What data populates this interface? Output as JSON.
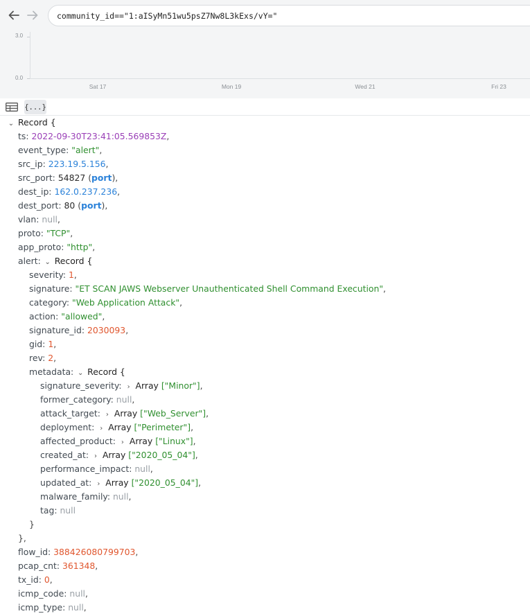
{
  "search": {
    "query": "community_id==\"1:aISyMn51wu5psZ7Nw8L3kExs/vY=\""
  },
  "histogram": {
    "y_labels": [
      "3.0",
      "0.0"
    ],
    "x_labels": [
      "Sat 17",
      "Mon 19",
      "Wed 21",
      "Fri 23"
    ]
  },
  "view": {
    "json_label": "{...}"
  },
  "record": {
    "root_label": "Record {",
    "ts": {
      "key": "ts:",
      "value": "2022-09-30T23:41:05.569853Z"
    },
    "event_type": {
      "key": "event_type:",
      "value": "\"alert\""
    },
    "src_ip": {
      "key": "src_ip:",
      "value": "223.19.5.156"
    },
    "src_port": {
      "key": "src_port:",
      "value": "54827",
      "type": "port"
    },
    "dest_ip": {
      "key": "dest_ip:",
      "value": "162.0.237.236"
    },
    "dest_port": {
      "key": "dest_port:",
      "value": "80",
      "type": "port"
    },
    "vlan": {
      "key": "vlan:",
      "value": "null"
    },
    "proto": {
      "key": "proto:",
      "value": "\"TCP\""
    },
    "app_proto": {
      "key": "app_proto:",
      "value": "\"http\""
    },
    "alert": {
      "key": "alert:",
      "label": "Record {",
      "severity": {
        "key": "severity:",
        "value": "1"
      },
      "signature": {
        "key": "signature:",
        "value": "\"ET SCAN JAWS Webserver Unauthenticated Shell Command Execution\""
      },
      "category": {
        "key": "category:",
        "value": "\"Web Application Attack\""
      },
      "action": {
        "key": "action:",
        "value": "\"allowed\""
      },
      "signature_id": {
        "key": "signature_id:",
        "value": "2030093"
      },
      "gid": {
        "key": "gid:",
        "value": "1"
      },
      "rev": {
        "key": "rev:",
        "value": "2"
      },
      "metadata": {
        "key": "metadata:",
        "label": "Record {",
        "array_label": "Array",
        "signature_severity": {
          "key": "signature_severity:",
          "value": "[\"Minor\"]"
        },
        "former_category": {
          "key": "former_category:",
          "value": "null"
        },
        "attack_target": {
          "key": "attack_target:",
          "value": "[\"Web_Server\"]"
        },
        "deployment": {
          "key": "deployment:",
          "value": "[\"Perimeter\"]"
        },
        "affected_product": {
          "key": "affected_product:",
          "value": "[\"Linux\"]"
        },
        "created_at": {
          "key": "created_at:",
          "value": "[\"2020_05_04\"]"
        },
        "performance_impact": {
          "key": "performance_impact:",
          "value": "null"
        },
        "updated_at": {
          "key": "updated_at:",
          "value": "[\"2020_05_04\"]"
        },
        "malware_family": {
          "key": "malware_family:",
          "value": "null"
        },
        "tag": {
          "key": "tag:",
          "value": "null"
        }
      }
    },
    "flow_id": {
      "key": "flow_id:",
      "value": "388426080799703"
    },
    "pcap_cnt": {
      "key": "pcap_cnt:",
      "value": "361348"
    },
    "tx_id": {
      "key": "tx_id:",
      "value": "0"
    },
    "icmp_code": {
      "key": "icmp_code:",
      "value": "null"
    },
    "icmp_type": {
      "key": "icmp_type:",
      "value": "null"
    }
  },
  "colors": {
    "string": "#2f8f2f",
    "number": "#e0562e",
    "timestamp": "#9a3fb7",
    "ip": "#2b82d9",
    "null": "#9aa0a6"
  }
}
